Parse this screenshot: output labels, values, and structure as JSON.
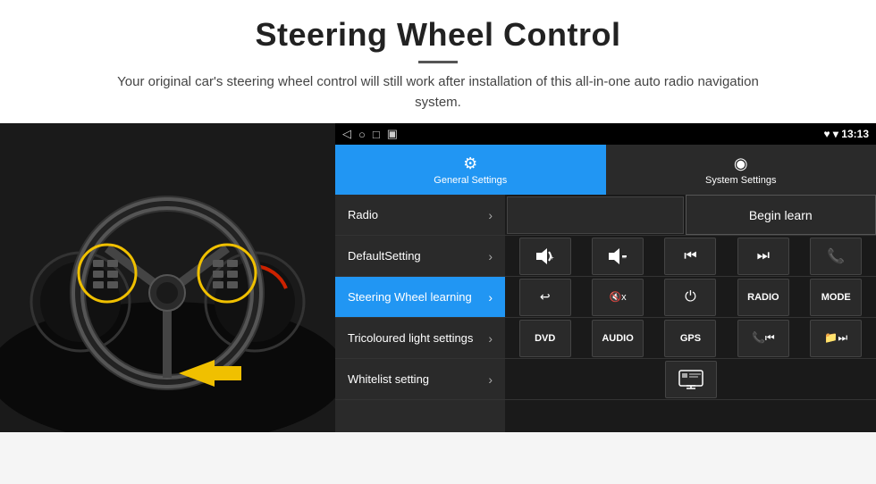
{
  "header": {
    "title": "Steering Wheel Control",
    "divider": true,
    "subtitle": "Your original car's steering wheel control will still work after installation of this all-in-one auto radio navigation system."
  },
  "statusBar": {
    "navIcons": [
      "◁",
      "○",
      "□",
      "▣"
    ],
    "rightIcons": "♥ ▾ ⊕",
    "time": "13:13"
  },
  "tabs": [
    {
      "id": "general",
      "label": "General Settings",
      "icon": "⚙",
      "active": true
    },
    {
      "id": "system",
      "label": "System Settings",
      "icon": "◉",
      "active": false
    }
  ],
  "menuItems": [
    {
      "id": "radio",
      "label": "Radio",
      "active": false
    },
    {
      "id": "defaultsetting",
      "label": "DefaultSetting",
      "active": false
    },
    {
      "id": "steering",
      "label": "Steering Wheel learning",
      "active": true
    },
    {
      "id": "tricoloured",
      "label": "Tricoloured light settings",
      "active": false
    },
    {
      "id": "whitelist",
      "label": "Whitelist setting",
      "active": false
    }
  ],
  "controlPanel": {
    "beginLearnLabel": "Begin learn",
    "row1Icons": [
      "🔊+",
      "🔊–",
      "⏮",
      "⏭",
      "📞"
    ],
    "row2Icons": [
      "↩",
      "🔇x",
      "⏻",
      "RADIO",
      "MODE"
    ],
    "row3Icons": [
      "DVD",
      "AUDIO",
      "GPS",
      "📞⏮",
      "📁⏭"
    ],
    "row4Icons": [
      "🖥"
    ]
  }
}
